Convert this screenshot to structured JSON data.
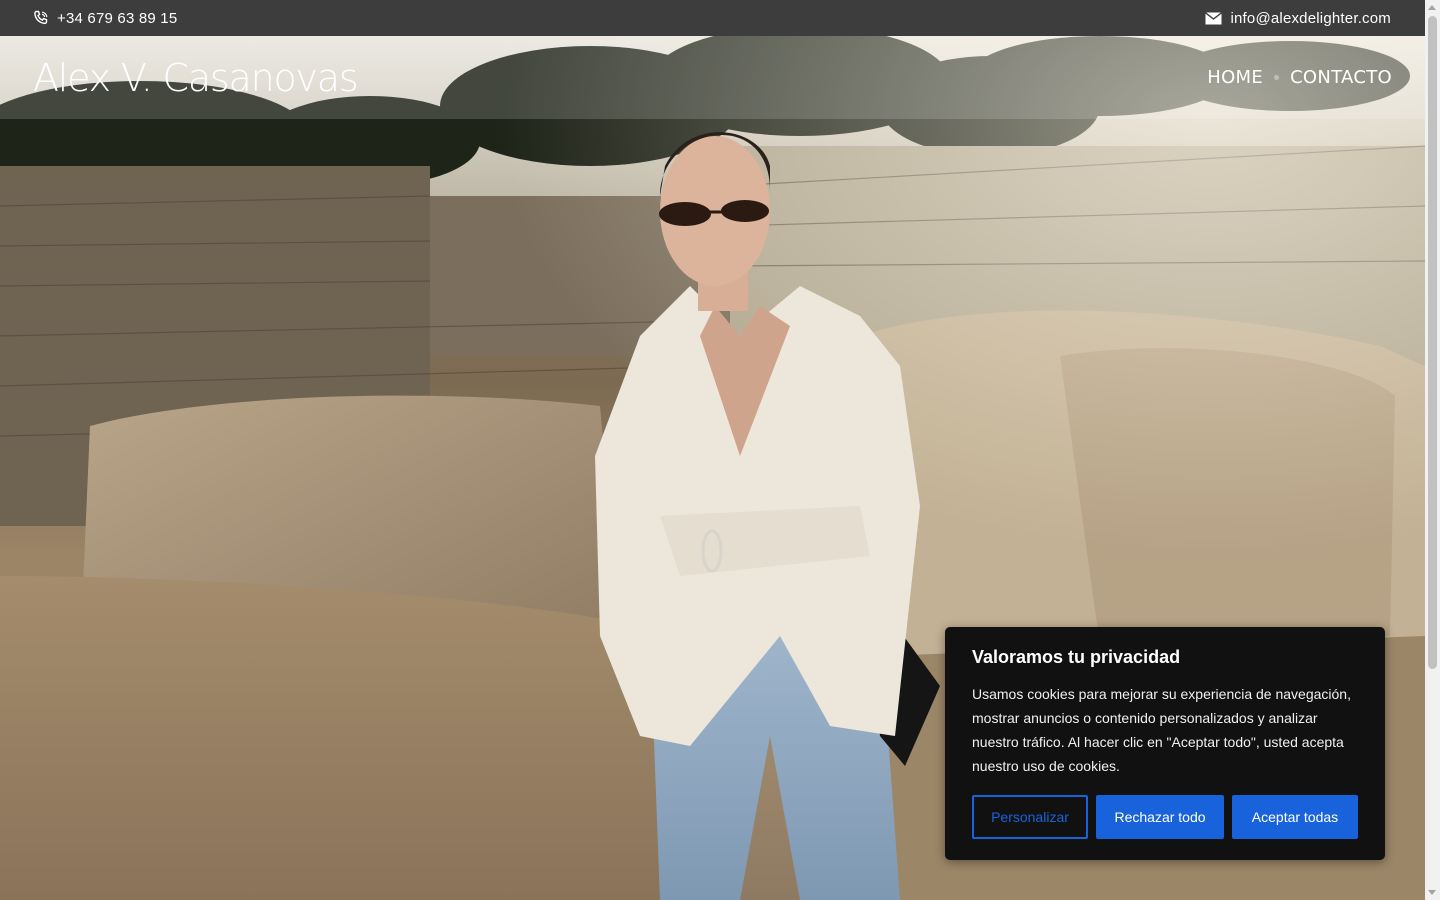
{
  "topbar": {
    "phone": "+34 679 63 89 15",
    "email": "info@alexdelighter.com",
    "phone_icon": "phone-icon",
    "email_icon": "envelope-icon"
  },
  "header": {
    "brand": "Alex V. Casanovas",
    "nav": [
      {
        "label": "HOME"
      },
      {
        "label": "CONTACTO"
      }
    ]
  },
  "cookie_banner": {
    "title": "Valoramos tu privacidad",
    "body": "Usamos cookies para mejorar su experiencia de navegación, mostrar anuncios o contenido personalizados y analizar nuestro tráfico. Al hacer clic en \"Aceptar todo\", usted acepta nuestro uso de cookies.",
    "customize_label": "Personalizar",
    "reject_label": "Rechazar todo",
    "accept_label": "Aceptar todas",
    "accent_color": "#1863dc",
    "background_color": "#111111"
  }
}
